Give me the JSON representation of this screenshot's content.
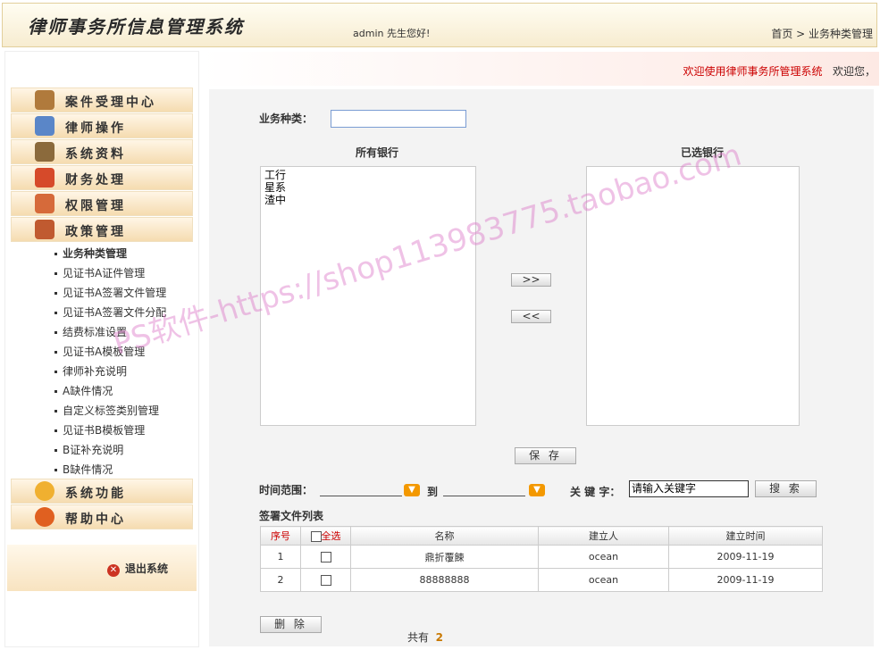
{
  "header": {
    "title": "律师事务所信息管理系统",
    "greeting": "admin 先生您好!",
    "breadcrumb": "首页 > 业务种类管理"
  },
  "sidebar": {
    "menu": [
      {
        "label": "案件受理中心",
        "icon": "case-icon"
      },
      {
        "label": "律师操作",
        "icon": "lawyer-icon"
      },
      {
        "label": "系统资料",
        "icon": "data-icon"
      },
      {
        "label": "财务处理",
        "icon": "finance-icon"
      },
      {
        "label": "权限管理",
        "icon": "permission-icon"
      },
      {
        "label": "政策管理",
        "icon": "policy-icon"
      }
    ],
    "submenu": [
      "业务种类管理",
      "见证书A证件管理",
      "见证书A签署文件管理",
      "见证书A签署文件分配",
      "结费标准设置",
      "见证书A模板管理",
      "律师补充说明",
      "A缺件情况",
      "自定义标签类别管理",
      "见证书B模板管理",
      "B证补充说明",
      "B缺件情况"
    ],
    "menu2": [
      {
        "label": "系统功能",
        "icon": "gear-icon"
      },
      {
        "label": "帮助中心",
        "icon": "help-icon"
      }
    ],
    "logout": "退出系统"
  },
  "welcome": {
    "text": "欢迎使用律师事务所管理系统",
    "tail": "欢迎您，"
  },
  "form": {
    "type_label": "业务种类：",
    "all_banks_label": "所有银行",
    "selected_banks_label": "已选银行",
    "all_banks": [
      "工行",
      "星系",
      "渣中"
    ],
    "add_btn": ">>",
    "remove_btn": "<<",
    "save_btn": "保 存"
  },
  "search": {
    "range_label": "时间范围：",
    "to_label": "到",
    "keyword_label": "关 键 字：",
    "keyword_value": "请输入关键字",
    "search_btn": "搜 索"
  },
  "table": {
    "title": "签署文件列表",
    "headers": [
      "序号",
      "全选",
      "名称",
      "建立人",
      "建立时间"
    ],
    "rows": [
      {
        "no": "1",
        "name": "鼎折覆餗",
        "creator": "ocean",
        "date": "2009-11-19"
      },
      {
        "no": "2",
        "name": "88888888",
        "creator": "ocean",
        "date": "2009-11-19"
      }
    ]
  },
  "footer": {
    "delete_btn": "删 除",
    "total_label": "共有",
    "total": "2"
  },
  "watermark": "PS软件-https://shop113983775.taobao.com",
  "colors": {
    "accent": "#f39800",
    "welcome": "#cc0000"
  }
}
